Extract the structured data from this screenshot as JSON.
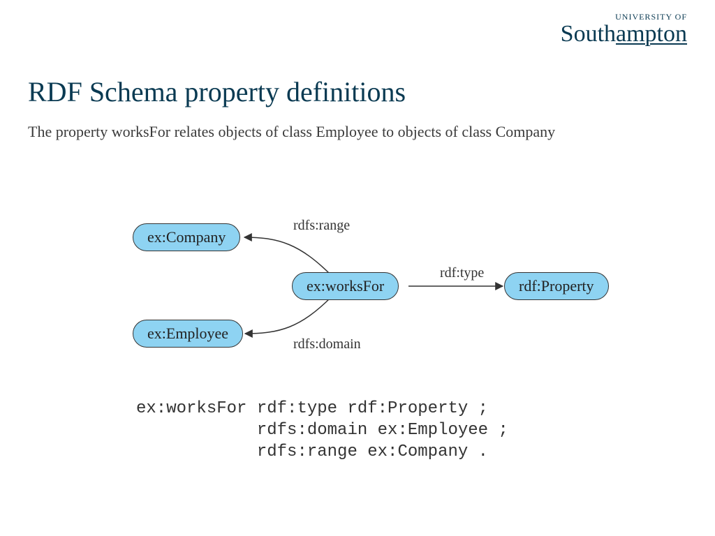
{
  "logo": {
    "top": "UNIVERSITY OF",
    "main_pre": "South",
    "main_hl": "ampton"
  },
  "title": "RDF Schema property definitions",
  "subtitle": "The property worksFor relates objects of class Employee to objects of class Company",
  "nodes": {
    "company": {
      "label": "ex:Company"
    },
    "employee": {
      "label": "ex:Employee"
    },
    "worksFor": {
      "label": "ex:worksFor"
    },
    "property": {
      "label": "rdf:Property"
    }
  },
  "edges": {
    "range": {
      "label": "rdfs:range"
    },
    "domain": {
      "label": "rdfs:domain"
    },
    "type": {
      "label": "rdf:type"
    }
  },
  "code": "ex:worksFor rdf:type rdf:Property ;\n            rdfs:domain ex:Employee ;\n            rdfs:range ex:Company ."
}
